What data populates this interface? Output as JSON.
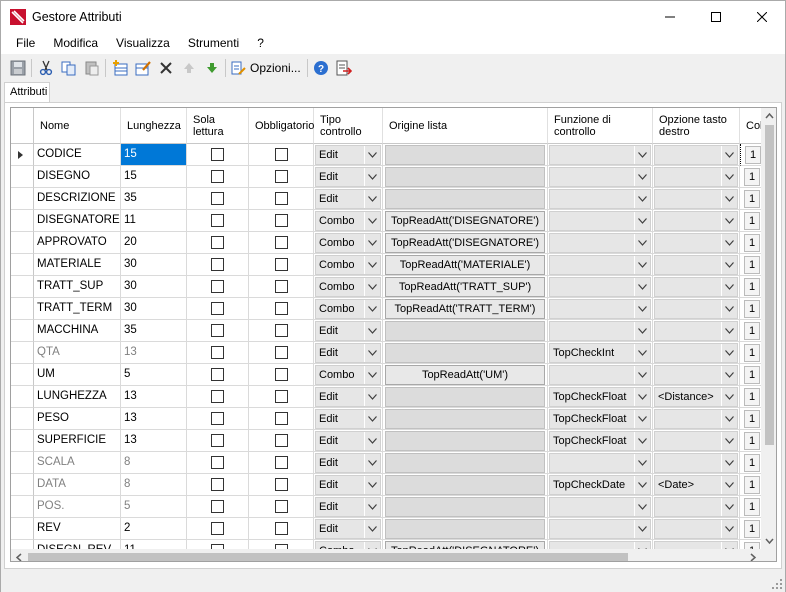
{
  "window": {
    "title": "Gestore Attributi"
  },
  "menu": [
    "File",
    "Modifica",
    "Visualizza",
    "Strumenti",
    "?"
  ],
  "toolbar": {
    "options_label": "Opzioni..."
  },
  "tab": {
    "label": "Attributi"
  },
  "columns": {
    "nome": "Nome",
    "lunghezza": "Lunghezza",
    "sola_lettura_1": "Sola",
    "sola_lettura_2": "lettura",
    "obbligatorio": "Obbligatorio",
    "tipo_1": "Tipo",
    "tipo_2": "controllo",
    "origine": "Origine lista",
    "funzione_1": "Funzione di",
    "funzione_2": "controllo",
    "opzione_1": "Opzione tasto",
    "opzione_2": "destro",
    "last": "Col"
  },
  "rows": [
    {
      "nome": "CODICE",
      "len": "15",
      "tipo": "Edit",
      "origine": "",
      "funzione": "",
      "opzione": "",
      "gray": false,
      "current": true
    },
    {
      "nome": "DISEGNO",
      "len": "15",
      "tipo": "Edit",
      "origine": "",
      "funzione": "",
      "opzione": "",
      "gray": false
    },
    {
      "nome": "DESCRIZIONE",
      "len": "35",
      "tipo": "Edit",
      "origine": "",
      "funzione": "",
      "opzione": "",
      "gray": false
    },
    {
      "nome": "DISEGNATORE",
      "len": "11",
      "tipo": "Combo",
      "origine": "TopReadAtt('DISEGNATORE')",
      "funzione": "",
      "opzione": "",
      "gray": false
    },
    {
      "nome": "APPROVATO",
      "len": "20",
      "tipo": "Combo",
      "origine": "TopReadAtt('DISEGNATORE')",
      "funzione": "",
      "opzione": "",
      "gray": false
    },
    {
      "nome": "MATERIALE",
      "len": "30",
      "tipo": "Combo",
      "origine": "TopReadAtt('MATERIALE')",
      "funzione": "",
      "opzione": "",
      "gray": false
    },
    {
      "nome": "TRATT_SUP",
      "len": "30",
      "tipo": "Combo",
      "origine": "TopReadAtt('TRATT_SUP')",
      "funzione": "",
      "opzione": "",
      "gray": false
    },
    {
      "nome": "TRATT_TERM",
      "len": "30",
      "tipo": "Combo",
      "origine": "TopReadAtt('TRATT_TERM')",
      "funzione": "",
      "opzione": "",
      "gray": false
    },
    {
      "nome": "MACCHINA",
      "len": "35",
      "tipo": "Edit",
      "origine": "",
      "funzione": "",
      "opzione": "",
      "gray": false
    },
    {
      "nome": "QTA",
      "len": "13",
      "tipo": "Edit",
      "origine": "",
      "funzione": "TopCheckInt",
      "opzione": "",
      "gray": true
    },
    {
      "nome": "UM",
      "len": "5",
      "tipo": "Combo",
      "origine": "TopReadAtt('UM')",
      "funzione": "",
      "opzione": "",
      "gray": false
    },
    {
      "nome": "LUNGHEZZA",
      "len": "13",
      "tipo": "Edit",
      "origine": "",
      "funzione": "TopCheckFloat",
      "opzione": "<Distance>",
      "gray": false
    },
    {
      "nome": "PESO",
      "len": "13",
      "tipo": "Edit",
      "origine": "",
      "funzione": "TopCheckFloat",
      "opzione": "",
      "gray": false
    },
    {
      "nome": "SUPERFICIE",
      "len": "13",
      "tipo": "Edit",
      "origine": "",
      "funzione": "TopCheckFloat",
      "opzione": "",
      "gray": false
    },
    {
      "nome": "SCALA",
      "len": "8",
      "tipo": "Edit",
      "origine": "",
      "funzione": "",
      "opzione": "",
      "gray": true
    },
    {
      "nome": "DATA",
      "len": "8",
      "tipo": "Edit",
      "origine": "",
      "funzione": "TopCheckDate",
      "opzione": "<Date>",
      "gray": true
    },
    {
      "nome": "POS.",
      "len": "5",
      "tipo": "Edit",
      "origine": "",
      "funzione": "",
      "opzione": "",
      "gray": true
    },
    {
      "nome": "REV",
      "len": "2",
      "tipo": "Edit",
      "origine": "",
      "funzione": "",
      "opzione": "",
      "gray": false
    },
    {
      "nome": "DISEGN_REV",
      "len": "11",
      "tipo": "Combo",
      "origine": "TopReadAtt('DISEGNATORE')",
      "funzione": "",
      "opzione": "",
      "gray": false
    }
  ],
  "last_col_value": "1"
}
